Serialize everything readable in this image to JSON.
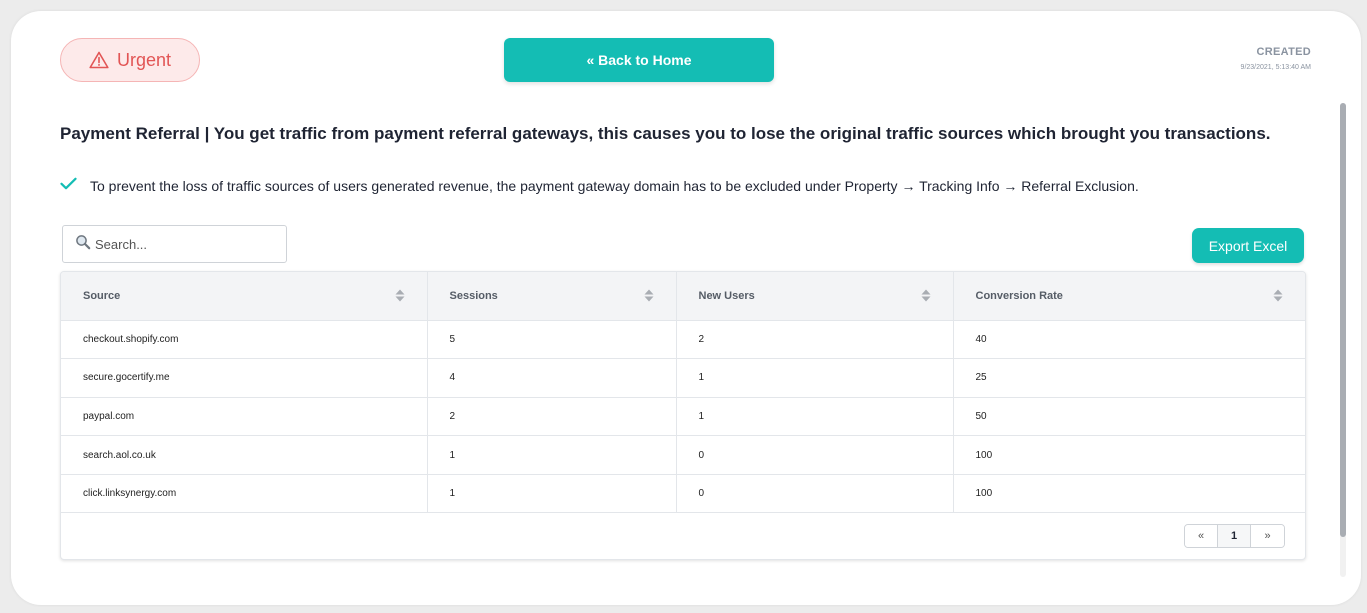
{
  "badge": {
    "label": "Urgent",
    "icon": "warning-triangle-icon",
    "color": "#e25555"
  },
  "nav": {
    "back_label": "« Back to Home"
  },
  "created": {
    "label": "CREATED",
    "date": "9/23/2021, 5:13:40 AM"
  },
  "heading": "Payment Referral | You get traffic from payment referral gateways, this causes you to lose the original traffic sources which brought you transactions.",
  "tip": {
    "icon": "check-icon",
    "text": "To prevent the loss of traffic sources of users generated revenue, the payment gateway domain has to be excluded under Property → Tracking Info → Referral Exclusion."
  },
  "search": {
    "placeholder": "Search...",
    "value": ""
  },
  "export": {
    "label": "Export Excel"
  },
  "table": {
    "columns": [
      "Source",
      "Sessions",
      "New Users",
      "Conversion Rate"
    ],
    "rows": [
      [
        "checkout.shopify.com",
        "5",
        "2",
        "40"
      ],
      [
        "secure.gocertify.me",
        "4",
        "1",
        "25"
      ],
      [
        "paypal.com",
        "2",
        "1",
        "50"
      ],
      [
        "search.aol.co.uk",
        "1",
        "0",
        "100"
      ],
      [
        "click.linksynergy.com",
        "1",
        "0",
        "100"
      ]
    ]
  },
  "pagination": {
    "prev": "«",
    "current": "1",
    "next": "»"
  },
  "colors": {
    "accent": "#14bdb4",
    "urgent_bg": "#fdeaea",
    "urgent_text": "#e25555"
  }
}
